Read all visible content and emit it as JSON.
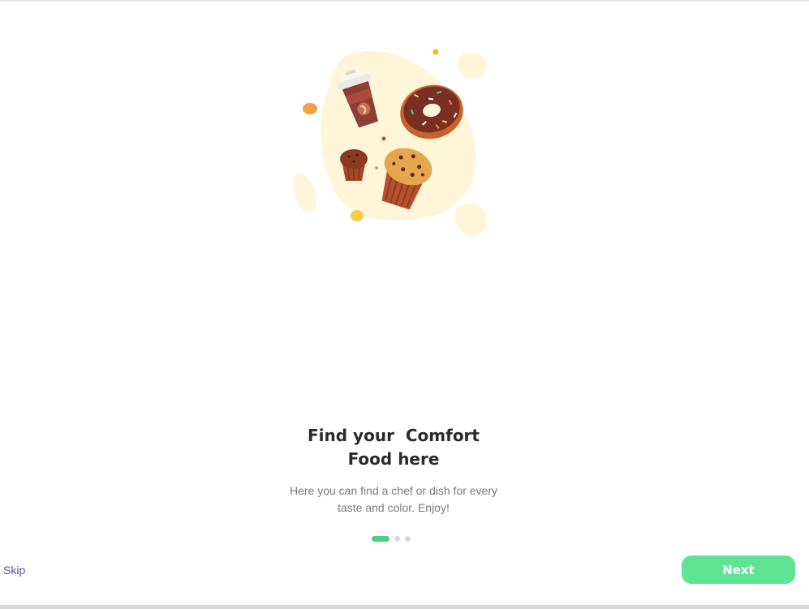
{
  "onboarding": {
    "title_line1": "Find your  Comfort",
    "title_line2": "Food here",
    "subtitle_line1": "Here you can find a chef or dish for every",
    "subtitle_line2": "taste and color. Enjoy!",
    "page_indicator": {
      "current": 1,
      "total": 3
    },
    "skip_label": "Skip",
    "next_label": "Next"
  },
  "colors": {
    "accent_green": "#5fe394",
    "indicator_active": "#4cd17e",
    "skip_link": "#5b4fa6",
    "hero_blob": "#fff6d9"
  },
  "illustration": {
    "subject": "food-illustration",
    "items": [
      "coffee-cup-icon",
      "donut-icon",
      "muffin-icon",
      "small-muffin-icon"
    ]
  }
}
